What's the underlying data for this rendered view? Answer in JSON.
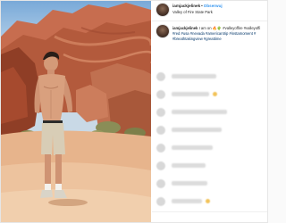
{
  "post": {
    "username": "iamjackjelinek",
    "follow_label": "Obserwuj",
    "location": "Valley of Fire State Park",
    "caption": {
      "username": "iamjackjelinek",
      "lines": [
        "I am on 🔥🌵 #valleyoffire #valleyoffi",
        "#red #usa #nevada #americantrip #instamoment #",
        "#breathtakingview #greattime"
      ]
    }
  },
  "comments": [
    {
      "bar_width": 50,
      "emoji": false
    },
    {
      "bar_width": 42,
      "emoji": true
    },
    {
      "bar_width": 62,
      "emoji": false
    },
    {
      "bar_width": 56,
      "emoji": false
    },
    {
      "bar_width": 46,
      "emoji": false
    },
    {
      "bar_width": 38,
      "emoji": false
    },
    {
      "bar_width": 40,
      "emoji": false
    },
    {
      "bar_width": 34,
      "emoji": true
    }
  ],
  "colors": {
    "link_blue": "#3897f0",
    "text": "#262626",
    "border": "#efefef"
  }
}
